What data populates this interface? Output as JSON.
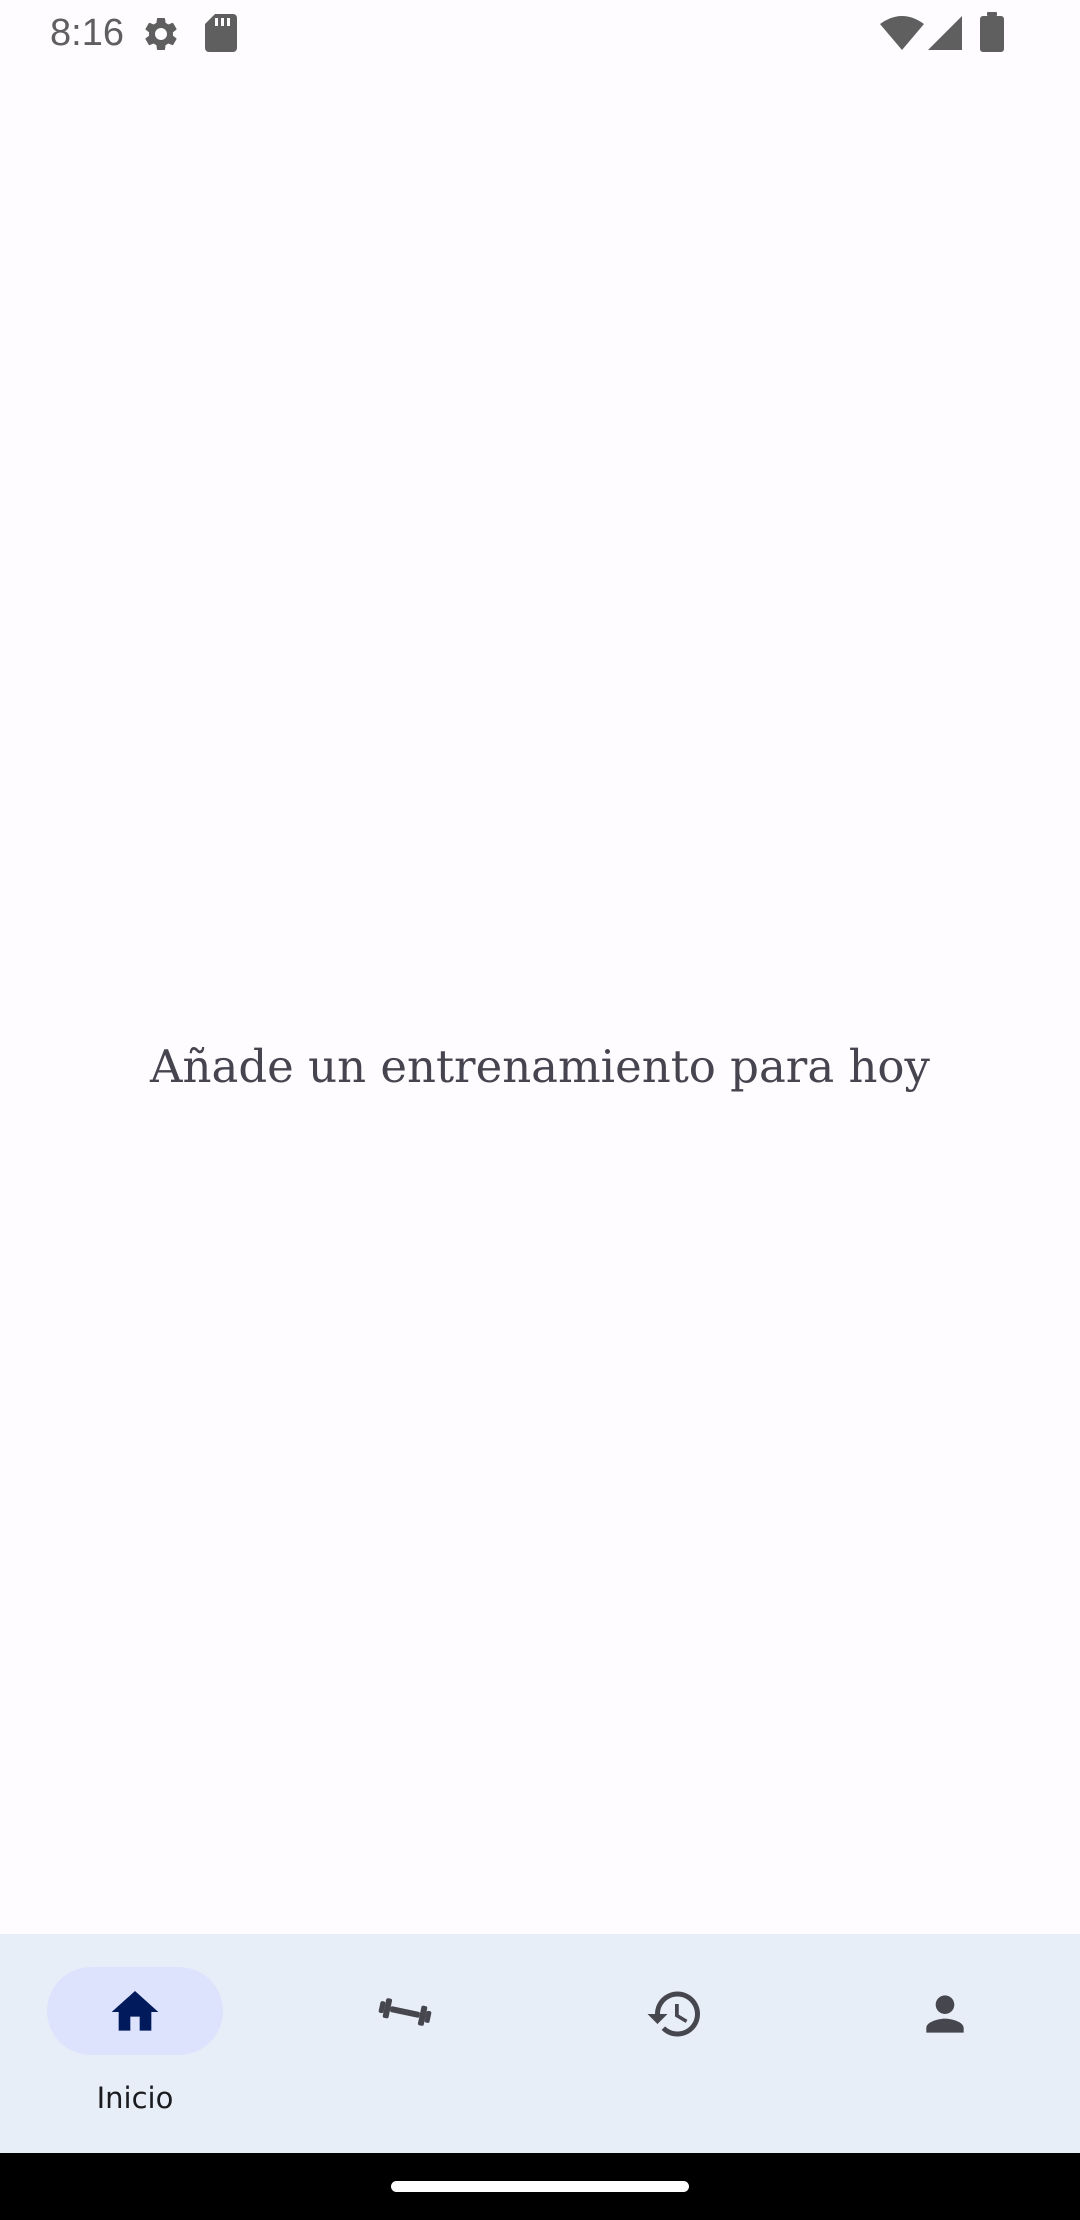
{
  "status_bar": {
    "time": "8:16",
    "icons": [
      "gear-icon",
      "sd-card-icon",
      "wifi-icon",
      "cell-signal-icon",
      "battery-icon"
    ]
  },
  "main": {
    "empty_message": "Añade un entrenamiento para hoy"
  },
  "bottom_nav": {
    "items": [
      {
        "id": "home",
        "label": "Inicio",
        "icon": "home-icon",
        "active": true
      },
      {
        "id": "workouts",
        "label": "",
        "icon": "dumbbell-icon",
        "active": false
      },
      {
        "id": "history",
        "label": "",
        "icon": "history-icon",
        "active": false
      },
      {
        "id": "profile",
        "label": "",
        "icon": "person-icon",
        "active": false
      }
    ]
  },
  "colors": {
    "background": "#fefcff",
    "nav_background": "#e8eef8",
    "active_pill": "#dde3fd",
    "active_icon": "#001a5c",
    "inactive_icon": "#46464f",
    "text": "#46454f"
  }
}
